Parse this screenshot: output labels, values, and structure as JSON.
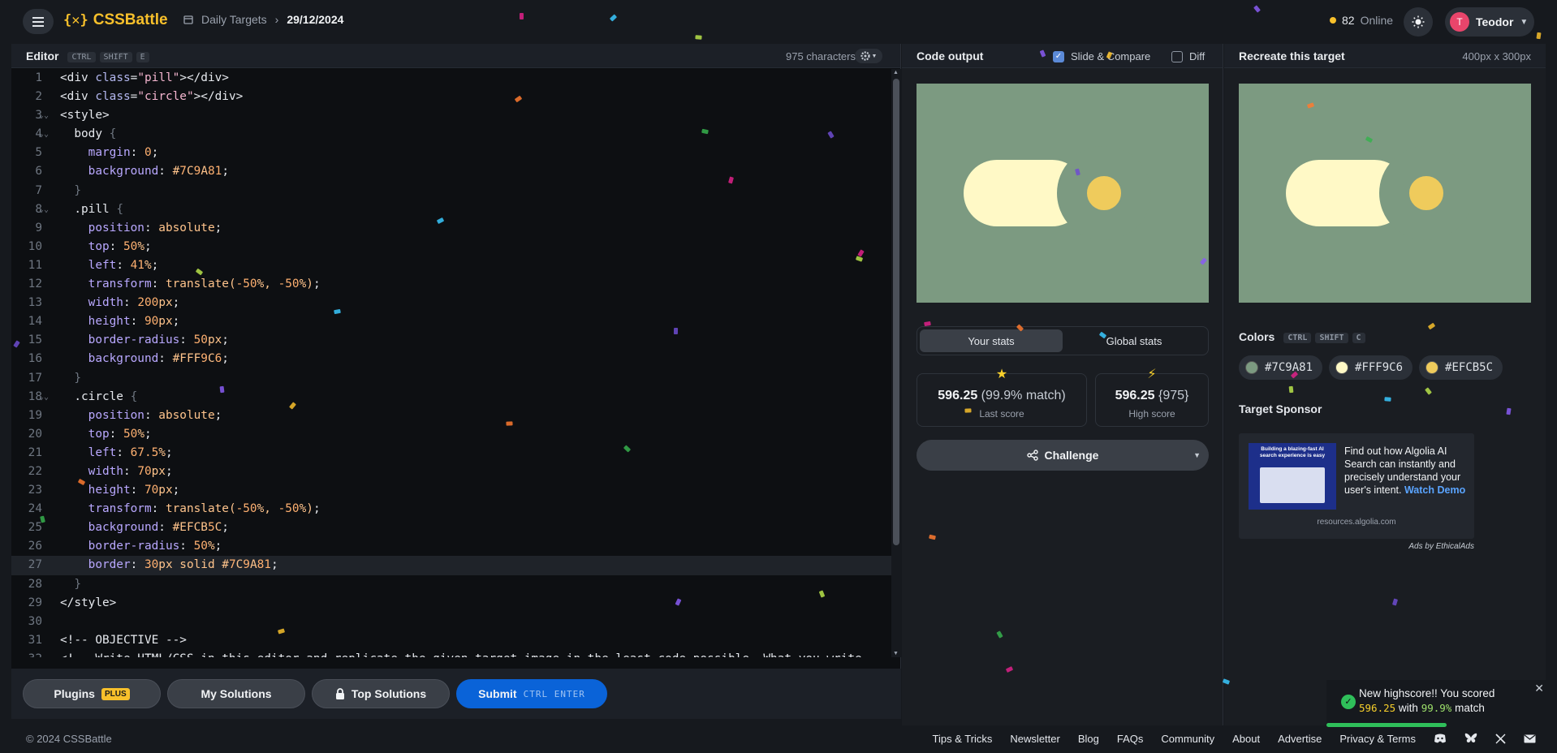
{
  "header": {
    "logo_text": "CSSBattle",
    "breadcrumb_parent": "Daily Targets",
    "breadcrumb_current": "29/12/2024",
    "online_count": "82",
    "online_label": "Online",
    "user_initial": "T",
    "user_name": "Teodor"
  },
  "editor": {
    "title": "Editor",
    "shortcut_keys": [
      "CTRL",
      "SHIFT",
      "E"
    ],
    "char_count": "975 characters",
    "lines": [
      "<div class=\"pill\"></div>",
      "<div class=\"circle\"></div>",
      "<style>",
      "  body {",
      "    margin: 0;",
      "    background: #7C9A81;",
      "  }",
      "  .pill {",
      "    position: absolute;",
      "    top: 50%;",
      "    left: 41%;",
      "    transform: translate(-50%, -50%);",
      "    width: 200px;",
      "    height: 90px;",
      "    border-radius: 50px;",
      "    background: #FFF9C6;",
      "  }",
      "  .circle {",
      "    position: absolute;",
      "    top: 50%;",
      "    left: 67.5%;",
      "    width: 70px;",
      "    height: 70px;",
      "    transform: translate(-50%, -50%);",
      "    background: #EFCB5C;",
      "    border-radius: 50%;",
      "    border: 30px solid #7C9A81;",
      "  }",
      "</style>",
      "",
      "<!-- OBJECTIVE -->",
      "<!-- Write HTML/CSS in this editor and replicate the given target image in the least code possible. What you write"
    ],
    "active_line": 27
  },
  "actions": {
    "plugins_label": "Plugins",
    "plus_badge": "PLUS",
    "my_solutions_label": "My Solutions",
    "top_solutions_label": "Top Solutions",
    "submit_label": "Submit",
    "submit_shortcut": "CTRL ENTER"
  },
  "output": {
    "title": "Code output",
    "slide_compare_label": "Slide & Compare",
    "slide_compare_checked": true,
    "diff_label": "Diff",
    "diff_checked": false,
    "tab_your_stats": "Your stats",
    "tab_global_stats": "Global stats",
    "last_score_value": "596.25",
    "last_score_match": "(99.9% match)",
    "last_score_label": "Last score",
    "high_score_value": "596.25",
    "high_score_chars": "{975}",
    "high_score_label": "High score",
    "challenge_label": "Challenge"
  },
  "target": {
    "title": "Recreate this target",
    "dimensions": "400px x 300px",
    "colors_title": "Colors",
    "colors_shortcut": [
      "CTRL",
      "SHIFT",
      "C"
    ],
    "colors": [
      {
        "hex": "#7C9A81"
      },
      {
        "hex": "#FFF9C6"
      },
      {
        "hex": "#EFCB5C"
      }
    ],
    "sponsor_title": "Target Sponsor",
    "ad_text": "Find out how Algolia AI Search can instantly and precisely understand your user's intent.",
    "ad_link": "Watch Demo",
    "ad_domain": "resources.algolia.com",
    "ads_by": "Ads by EthicalAds",
    "ad_image_text": "Building a blazing-fast AI search experience is easy"
  },
  "toast": {
    "line1": "New highscore!! You scored",
    "score": "596.25",
    "with": "with",
    "match": "99.9%",
    "suffix": "match"
  },
  "footer": {
    "copyright": "© 2024 CSSBattle",
    "links": [
      "Tips & Tricks",
      "Newsletter",
      "Blog",
      "FAQs",
      "Community",
      "About",
      "Advertise",
      "Privacy & Terms"
    ]
  },
  "colors": {
    "accent": "#f8c02b",
    "submit": "#0a63d8",
    "canvas_bg": "#7C9A81",
    "pill": "#FFF9C6",
    "circle": "#EFCB5C"
  }
}
